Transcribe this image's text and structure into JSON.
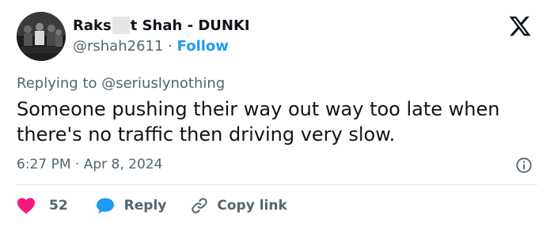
{
  "author": {
    "name_prefix": "Raks",
    "name_suffix": "t Shah - DUNKI",
    "handle": "@rshah2611",
    "separator": "·",
    "follow_label": "Follow"
  },
  "tweet": {
    "reply_prefix": "Replying to ",
    "reply_handle": "@seriuslynothing",
    "text_lines": [
      "Someone pushing their way out way too late when",
      "there's no traffic then driving very slow."
    ],
    "timestamp": "6:27 PM · Apr 8, 2024"
  },
  "actions": {
    "likes": "52",
    "reply_label": "Reply",
    "copy_label": "Copy link"
  },
  "colors": {
    "accent": "#1d9bf0",
    "like": "#f91880",
    "muted": "#536471",
    "text": "#0f1419"
  },
  "icons": [
    "x-logo-icon",
    "info-icon",
    "heart-icon",
    "reply-bubble-icon",
    "link-icon"
  ]
}
